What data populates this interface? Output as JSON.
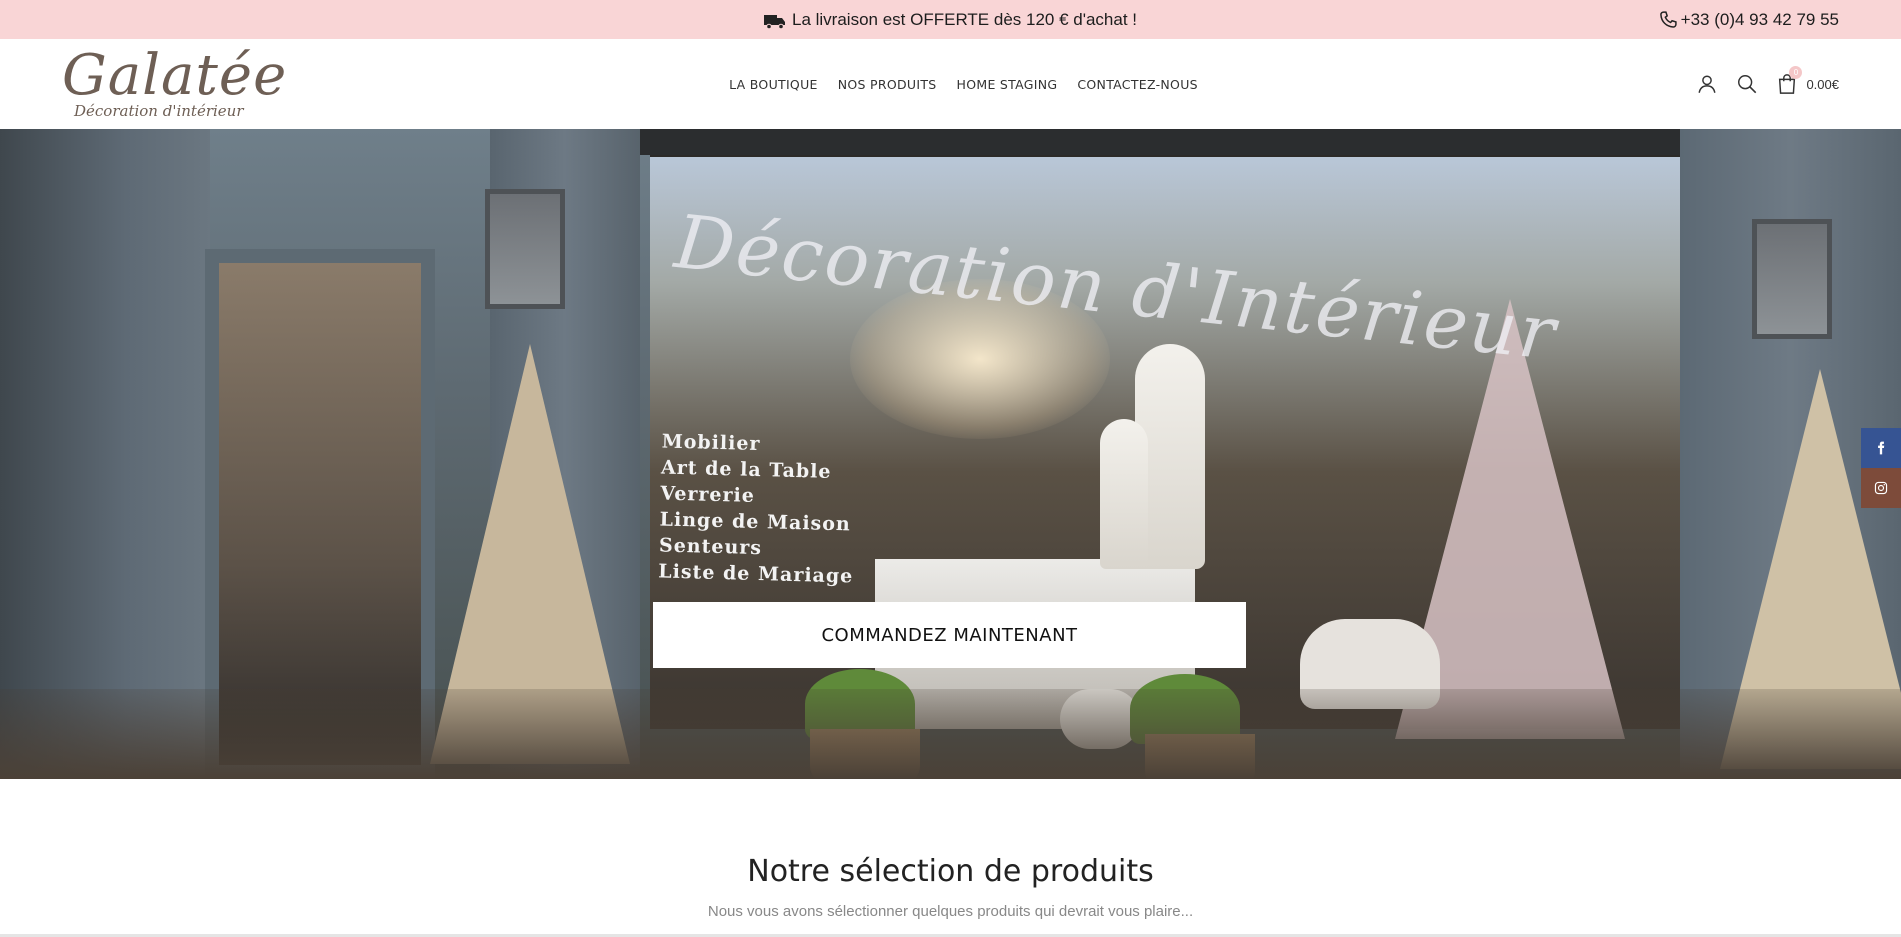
{
  "topbar": {
    "promo_text": "La livraison est OFFERTE dès 120 € d'achat !",
    "phone": "+33 (0)4 93 42 79 55",
    "background": "#f9d5d6"
  },
  "logo": {
    "name": "Galatée",
    "tagline": "Décoration d'intérieur"
  },
  "nav": {
    "items": [
      {
        "label": "LA BOUTIQUE"
      },
      {
        "label": "NOS PRODUITS"
      },
      {
        "label": "HOME STAGING"
      },
      {
        "label": "CONTACTEZ-NOUS"
      }
    ]
  },
  "header_actions": {
    "account_icon": "user-icon",
    "search_icon": "search-icon",
    "cart_icon": "shopping-bag-icon",
    "cart_count": "0",
    "cart_total": "0.00€"
  },
  "hero": {
    "window_script": "Décoration d'Intérieur",
    "decal_lines": [
      "Mobilier",
      "Art de la Table",
      "Verrerie",
      "Linge de Maison",
      "Senteurs",
      "Liste de Mariage"
    ],
    "cta_label": "COMMANDEZ MAINTENANT"
  },
  "social": {
    "facebook_icon": "facebook-icon",
    "instagram_icon": "instagram-icon",
    "facebook_color": "#365493",
    "instagram_color": "#7d4b3a"
  },
  "section": {
    "title": "Notre sélection de produits",
    "subtitle": "Nous vous avons sélectionner quelques produits qui devrait vous plaire..."
  }
}
